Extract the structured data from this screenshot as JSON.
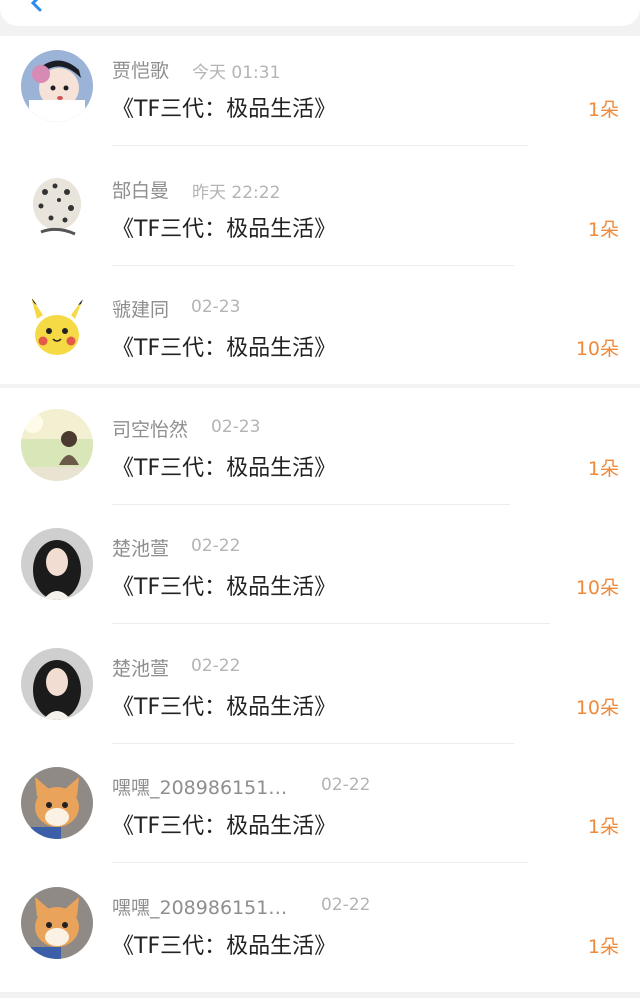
{
  "header": {
    "back_icon": "chevron-left-icon"
  },
  "accent_color": "#ef8a3b",
  "gifts": [
    {
      "name": "贾恺歌",
      "time": "今天 01:31",
      "title": "《TF三代：极品生活》",
      "count": "1朵",
      "avatar": "anime-girl-avatar"
    },
    {
      "name": "郜白曼",
      "time": "昨天 22:22",
      "title": "《TF三代：极品生活》",
      "count": "1朵",
      "avatar": "leopard-avatar"
    },
    {
      "name": "虢建同",
      "time": "02-23",
      "title": "《TF三代：极品生活》",
      "count": "10朵",
      "avatar": "pikachu-avatar"
    },
    {
      "name": "司空怡然",
      "time": "02-23",
      "title": "《TF三代：极品生活》",
      "count": "1朵",
      "avatar": "girl-sunset-avatar"
    },
    {
      "name": "楚池萱",
      "time": "02-22",
      "title": "《TF三代：极品生活》",
      "count": "10朵",
      "avatar": "girl-portrait-avatar"
    },
    {
      "name": "楚池萱",
      "time": "02-22",
      "title": "《TF三代：极品生活》",
      "count": "10朵",
      "avatar": "girl-portrait-avatar"
    },
    {
      "name": "嘿嘿_208986151…",
      "time": "02-22",
      "title": "《TF三代：极品生活》",
      "count": "1朵",
      "avatar": "kitten-avatar"
    },
    {
      "name": "嘿嘿_208986151…",
      "time": "02-22",
      "title": "《TF三代：极品生活》",
      "count": "1朵",
      "avatar": "kitten-avatar"
    }
  ]
}
